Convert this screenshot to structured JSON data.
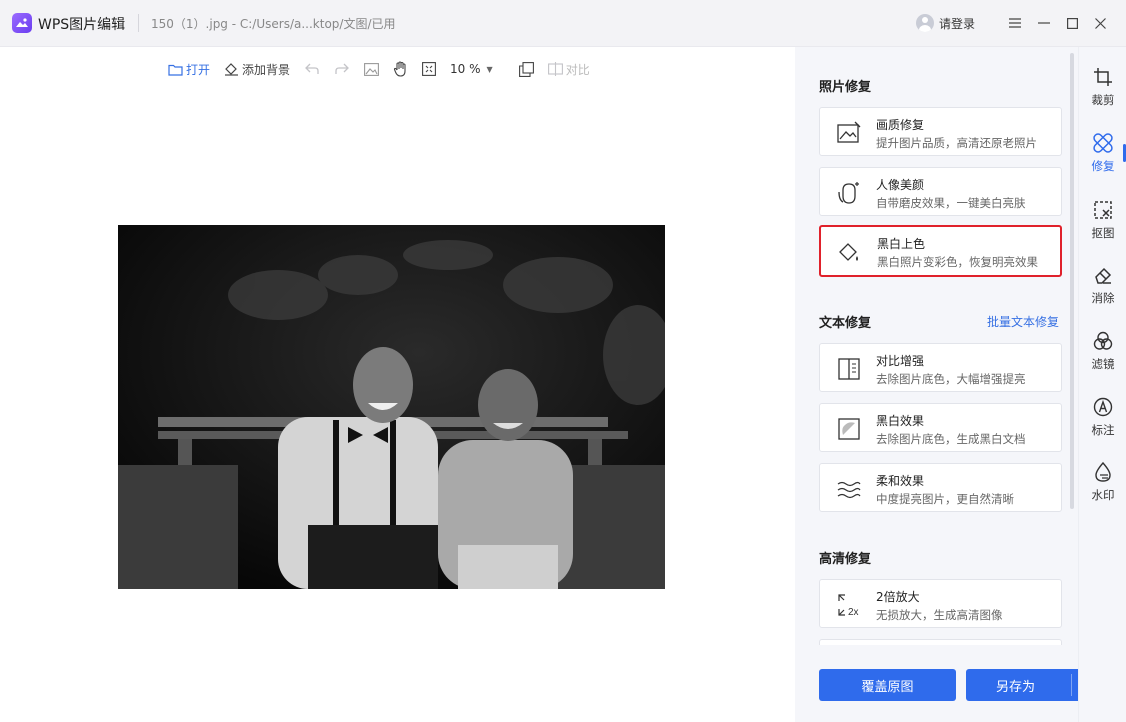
{
  "titlebar": {
    "app_name": "WPS图片编辑",
    "file_path": "150（1）.jpg - C:/Users/a...ktop/文图/已用",
    "login_label": "请登录"
  },
  "toolbar": {
    "open_label": "打开",
    "add_bg_label": "添加背景",
    "zoom_value": "10 %",
    "compare_label": "对比"
  },
  "panel": {
    "photo_repair": {
      "title": "照片修复",
      "cards": [
        {
          "title": "画质修复",
          "desc": "提升图片品质，高清还原老照片",
          "icon": "image-quality-icon"
        },
        {
          "title": "人像美颜",
          "desc": "自带磨皮效果，一键美白亮肤",
          "icon": "portrait-beauty-icon"
        },
        {
          "title": "黑白上色",
          "desc": "黑白照片变彩色，恢复明亮效果",
          "icon": "colorize-icon"
        }
      ]
    },
    "text_repair": {
      "title": "文本修复",
      "link": "批量文本修复",
      "cards": [
        {
          "title": "对比增强",
          "desc": "去除图片底色，大幅增强提亮",
          "icon": "contrast-icon"
        },
        {
          "title": "黑白效果",
          "desc": "去除图片底色，生成黑白文档",
          "icon": "bw-effect-icon"
        },
        {
          "title": "柔和效果",
          "desc": "中度提亮图片，更自然清晰",
          "icon": "soft-effect-icon"
        }
      ]
    },
    "hd_repair": {
      "title": "高清修复",
      "cards": [
        {
          "title": "2倍放大",
          "desc": "无损放大，生成高清图像",
          "icon": "upscale-2x-icon",
          "icon_text": "2x"
        }
      ]
    },
    "overwrite_label": "覆盖原图",
    "save_as_label": "另存为"
  },
  "rail": [
    {
      "label": "裁剪",
      "icon": "crop-icon"
    },
    {
      "label": "修复",
      "icon": "repair-icon"
    },
    {
      "label": "抠图",
      "icon": "cutout-icon"
    },
    {
      "label": "消除",
      "icon": "eraser-icon"
    },
    {
      "label": "滤镜",
      "icon": "filter-icon"
    },
    {
      "label": "标注",
      "icon": "annotate-icon"
    },
    {
      "label": "水印",
      "icon": "watermark-icon"
    }
  ],
  "colors": {
    "accent": "#2f6bec",
    "selected_border": "#e0212b",
    "link": "#3670e3"
  }
}
